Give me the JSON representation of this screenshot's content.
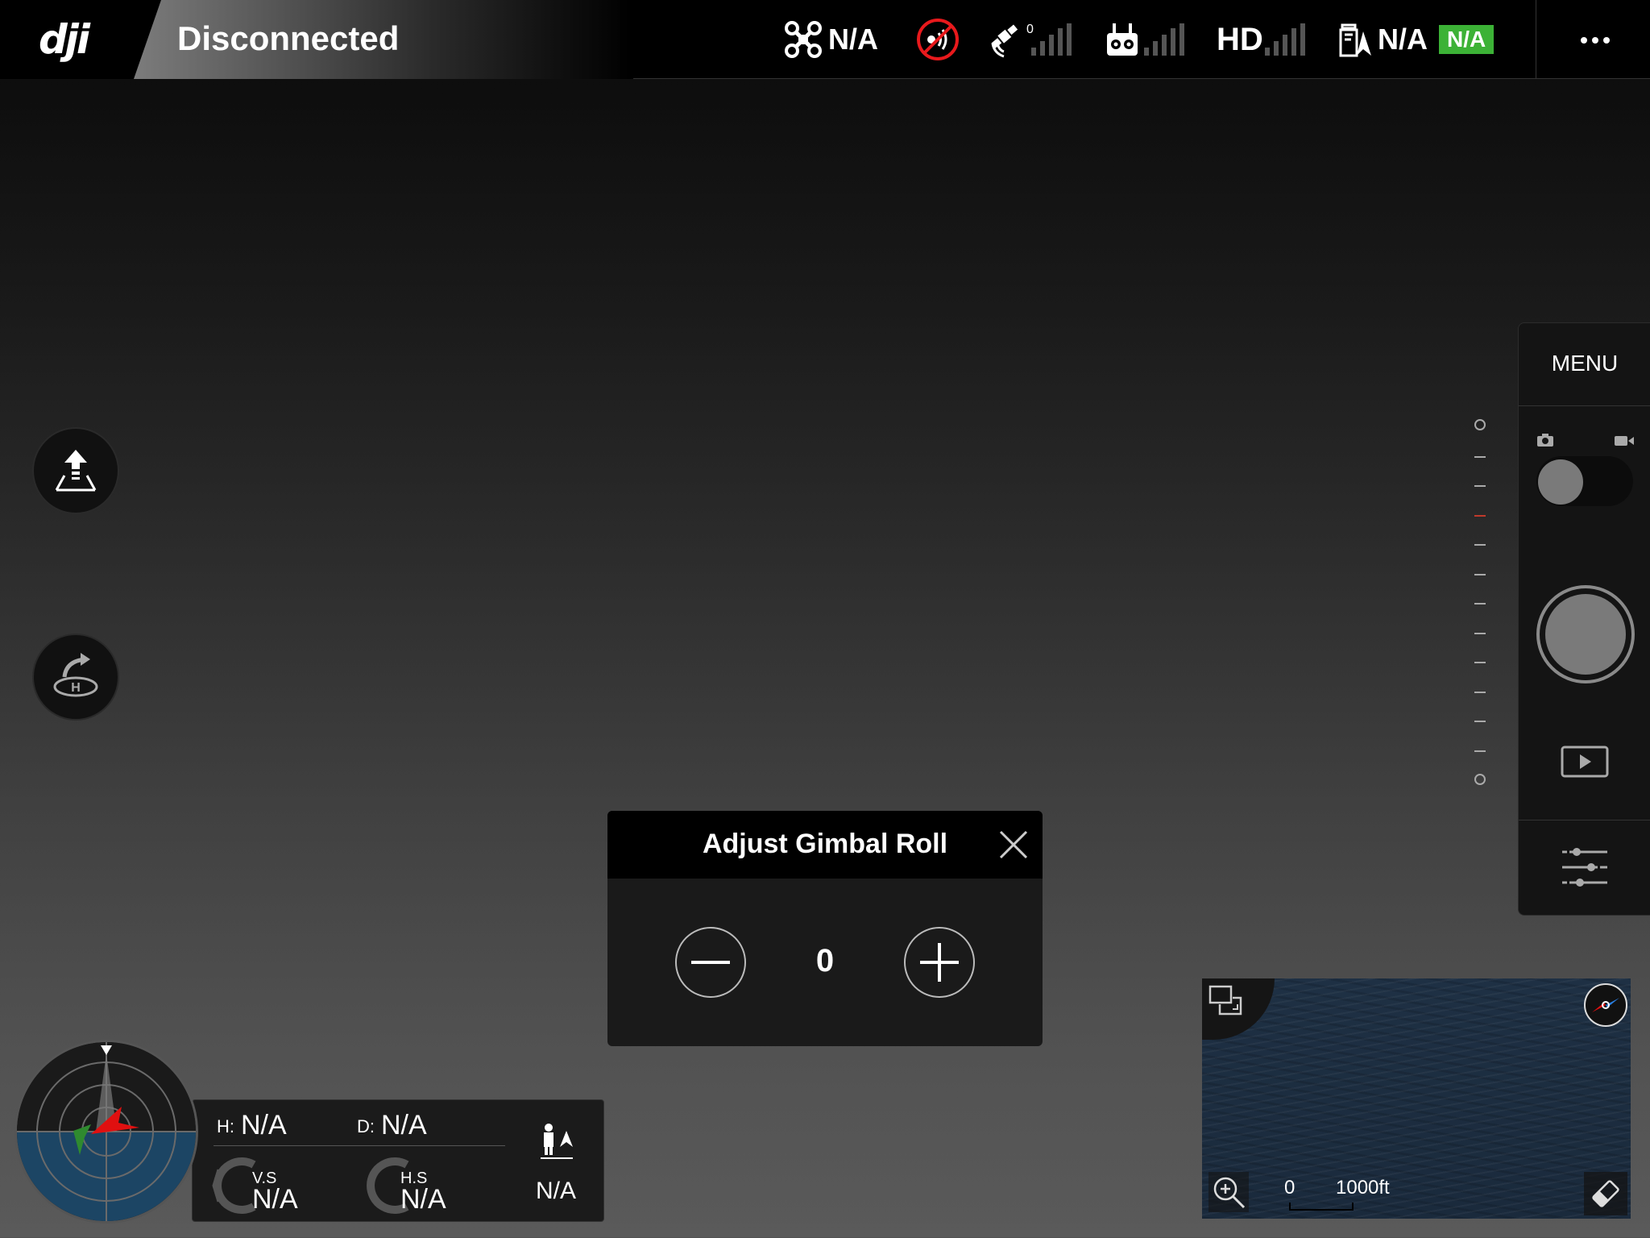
{
  "topbar": {
    "logo": "dji",
    "connection_status": "Disconnected",
    "aircraft_status": "N/A",
    "satellite_count": "0",
    "hd_label": "HD",
    "battery_status": "N/A",
    "battery_badge": "N/A",
    "more_label": "•••"
  },
  "right_panel": {
    "menu_label": "MENU"
  },
  "dialog": {
    "title": "Adjust Gimbal Roll",
    "value": "0"
  },
  "telemetry": {
    "height_label": "H:",
    "height_value": "N/A",
    "distance_label": "D:",
    "distance_value": "N/A",
    "vspeed_label": "V.S",
    "vspeed_value": "N/A",
    "hspeed_label": "H.S",
    "hspeed_value": "N/A",
    "vps_value": "N/A"
  },
  "minimap": {
    "scale_start": "0",
    "scale_end": "1000ft"
  },
  "colors": {
    "battery_badge": "#3cb236",
    "warning_red": "#e8191c",
    "radar_home": "#2f8a2f",
    "radar_aircraft": "#e01010",
    "ev_marker": "#c0392b"
  }
}
